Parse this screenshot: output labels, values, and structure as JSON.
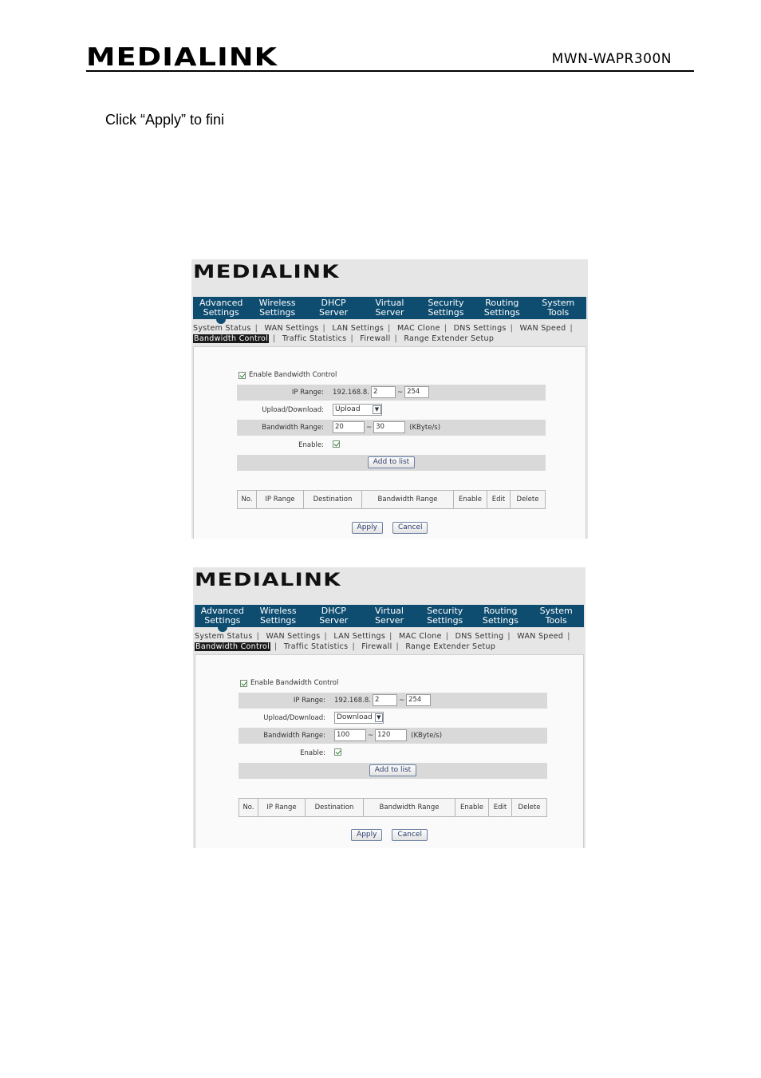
{
  "document": {
    "logo": "MEDIALINK",
    "model": "MWN-WAPR300N",
    "instruction": "Click “Apply” to fini"
  },
  "screenshots": [
    {
      "logo": "MEDIALINK",
      "nav": [
        "Advanced\nSettings",
        "Wireless\nSettings",
        "DHCP\nServer",
        "Virtual\nServer",
        "Security\nSettings",
        "Routing\nSettings",
        "System\nTools"
      ],
      "subnav": {
        "line1": [
          "System Status",
          "WAN Settings",
          "LAN Settings",
          "MAC Clone",
          "DNS Settings",
          "WAN Speed"
        ],
        "active": "Bandwidth Control",
        "line2": [
          "Traffic Statistics",
          "Firewall",
          "Range Extender Setup"
        ]
      },
      "form": {
        "enable_bw_label": "Enable Bandwidth Control",
        "ip_range_label": "IP Range:",
        "ip_prefix": "192.168.8.",
        "ip_start": "2",
        "ip_sep": "~",
        "ip_end": "254",
        "updown_label": "Upload/Download:",
        "updown_value": "Upload",
        "bw_range_label": "Bandwidth Range:",
        "bw_min": "20",
        "bw_sep": "~",
        "bw_max": "30",
        "bw_unit": "(KByte/s)",
        "enable_label": "Enable:",
        "add_button": "Add to list"
      },
      "table_headers": [
        "No.",
        "IP Range",
        "Destination",
        "Bandwidth Range",
        "Enable",
        "Edit",
        "Delete"
      ],
      "apply": "Apply",
      "cancel": "Cancel"
    },
    {
      "logo": "MEDIALINK",
      "nav": [
        "Advanced\nSettings",
        "Wireless\nSettings",
        "DHCP\nServer",
        "Virtual\nServer",
        "Security\nSettings",
        "Routing\nSettings",
        "System\nTools"
      ],
      "subnav": {
        "line1": [
          "System Status",
          "WAN Settings",
          "LAN Settings",
          "MAC Clone",
          "DNS Setting",
          "WAN Speed"
        ],
        "active": "Bandwidth Control",
        "line2": [
          "Traffic Statistics",
          "Firewall",
          "Range Extender Setup"
        ]
      },
      "form": {
        "enable_bw_label": "Enable Bandwidth Control",
        "ip_range_label": "IP Range:",
        "ip_prefix": "192.168.8.",
        "ip_start": "2",
        "ip_sep": "~",
        "ip_end": "254",
        "updown_label": "Upload/Download:",
        "updown_value": "Download",
        "bw_range_label": "Bandwidth Range:",
        "bw_min": "100",
        "bw_sep": "~",
        "bw_max": "120",
        "bw_unit": "(KByte/s)",
        "enable_label": "Enable:",
        "add_button": "Add to list"
      },
      "table_headers": [
        "No.",
        "IP Range",
        "Destination",
        "Bandwidth Range",
        "Enable",
        "Edit",
        "Delete"
      ],
      "apply": "Apply",
      "cancel": "Cancel"
    }
  ]
}
